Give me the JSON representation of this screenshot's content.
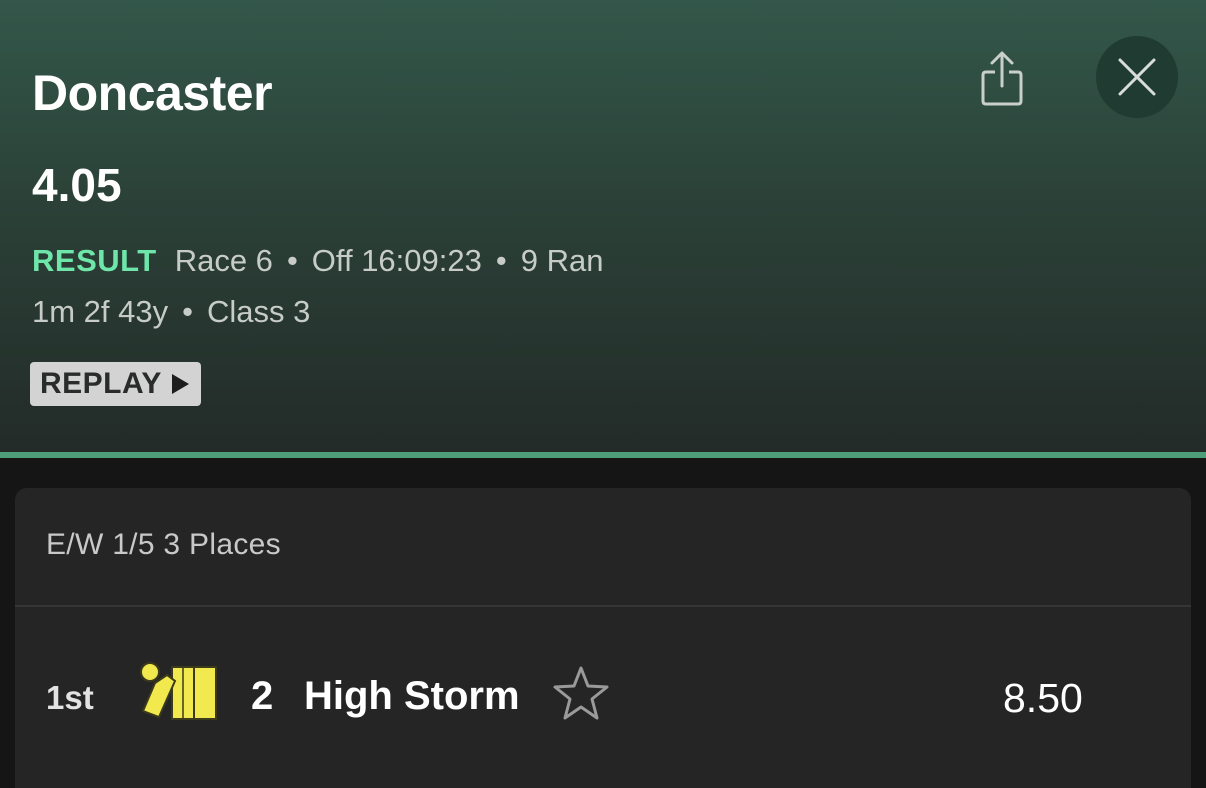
{
  "race": {
    "venue": "Doncaster",
    "time": "4.05",
    "status": "RESULT",
    "race_number": "Race 6",
    "off_time": "Off 16:09:23",
    "runners": "9 Ran",
    "distance": "1m 2f 43y",
    "class": "Class 3",
    "replay_label": "REPLAY"
  },
  "actions": {
    "share_icon": "share-icon",
    "close_icon": "close-icon"
  },
  "market": {
    "each_way_terms": "E/W 1/5 3 Places",
    "results": [
      {
        "position": "1st",
        "cloth_number": "2",
        "horse_name": "High Storm",
        "price": "8.50",
        "silks_colors": [
          "#f2e94e",
          "#f2e94e"
        ],
        "favourite_icon": "star-outline-icon"
      }
    ]
  },
  "colors": {
    "accent": "#4e9e79",
    "result_green": "#6fe6a9",
    "header_top": "#33574a",
    "card_background": "#252525"
  }
}
